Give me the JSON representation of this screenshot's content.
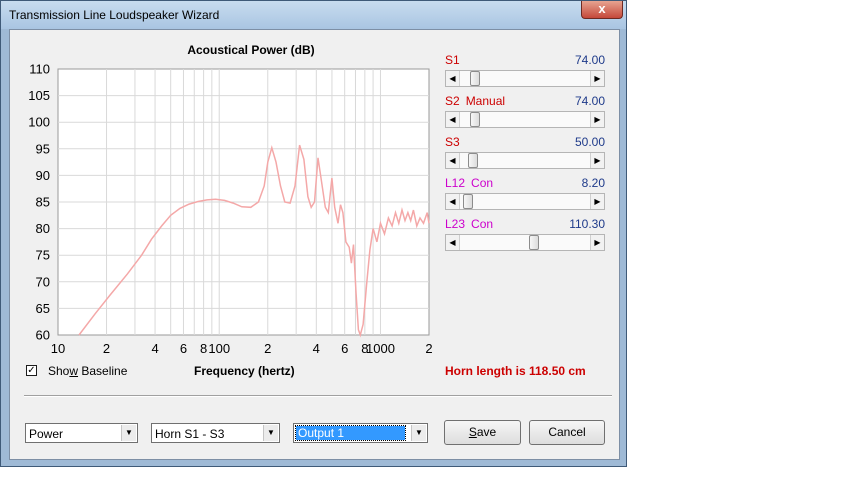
{
  "window": {
    "title": "Transmission Line Loudspeaker Wizard",
    "close_glyph": "x"
  },
  "chart": {
    "title": "Acoustical Power (dB)",
    "x_axis_label": "Frequency (hertz)",
    "y_ticks": [
      "110",
      "105",
      "100",
      "95",
      "90",
      "85",
      "80",
      "75",
      "70",
      "65",
      "60"
    ],
    "x_ticks": [
      "10",
      "2",
      "4",
      "6",
      "8",
      "100",
      "2",
      "4",
      "6",
      "8",
      "1000",
      "2"
    ]
  },
  "chart_data": {
    "type": "line",
    "title": "Acoustical Power (dB)",
    "xlabel": "Frequency (hertz)",
    "ylabel": "",
    "xscale": "log",
    "xlim": [
      10,
      2000
    ],
    "ylim": [
      60,
      110
    ],
    "grid": true,
    "series": [
      {
        "color": "#f4a8a8",
        "x": [
          13.5,
          17,
          21,
          27,
          33,
          38,
          44,
          50,
          57,
          65,
          74,
          84,
          95,
          108,
          122,
          138,
          157,
          175,
          190,
          200,
          212,
          225,
          240,
          255,
          275,
          295,
          315,
          335,
          355,
          372,
          390,
          410,
          430,
          455,
          475,
          500,
          520,
          545,
          565,
          585,
          610,
          640,
          660,
          680,
          705,
          730,
          750,
          780,
          820,
          860,
          900,
          950,
          1000,
          1060,
          1120,
          1180,
          1240,
          1300,
          1360,
          1420,
          1480,
          1540,
          1600,
          1680,
          1760,
          1850,
          1950,
          2000
        ],
        "y": [
          60,
          64,
          67.5,
          71.5,
          75,
          78,
          80.5,
          82.5,
          83.8,
          84.6,
          85.1,
          85.4,
          85.5,
          85.3,
          84.8,
          84.1,
          84.0,
          85.0,
          88.0,
          92.5,
          95.2,
          92.5,
          88.0,
          85.0,
          84.8,
          88.0,
          95.7,
          93.0,
          86.0,
          84.0,
          85.0,
          93.3,
          89.0,
          84.0,
          83.0,
          89.5,
          84.0,
          81.0,
          84.5,
          83.0,
          77.5,
          76.5,
          73.5,
          77.0,
          68.0,
          61.0,
          60.0,
          62.0,
          69.5,
          76.0,
          80.0,
          77.5,
          81.0,
          79.0,
          82.0,
          80.5,
          83.0,
          81.0,
          83.5,
          81.5,
          83.0,
          81.5,
          83.5,
          80.5,
          82.0,
          81.0,
          83.0,
          81.0
        ]
      }
    ]
  },
  "sliders": [
    {
      "name": "S1",
      "mode": "",
      "value": "74.00",
      "position": 0.09,
      "label_color": "#cc0000"
    },
    {
      "name": "S2",
      "mode": "Manual",
      "value": "74.00",
      "position": 0.09,
      "label_color": "#cc0000"
    },
    {
      "name": "S3",
      "mode": "",
      "value": "50.00",
      "position": 0.07,
      "label_color": "#cc0000"
    },
    {
      "name": "L12",
      "mode": "Con",
      "value": "8.20",
      "position": 0.03,
      "label_color": "#cc00cc"
    },
    {
      "name": "L23",
      "mode": "Con",
      "value": "110.30",
      "position": 0.57,
      "label_color": "#cc00cc"
    }
  ],
  "show_baseline": {
    "label_before": "Sho",
    "label_mnemonic": "w",
    "label_after": " Baseline",
    "checked": true,
    "check_glyph": "✓"
  },
  "horn_length": "Horn length is 118.50 cm",
  "dropdowns": [
    {
      "value": "Power"
    },
    {
      "value": "Horn S1 - S3"
    },
    {
      "value": "Output 1"
    }
  ],
  "buttons": {
    "save_mnemonic": "S",
    "save_rest": "ave",
    "cancel": "Cancel"
  },
  "glyphs": {
    "arrow_left": "◀",
    "arrow_right": "▶",
    "arrow_down": "▼"
  }
}
